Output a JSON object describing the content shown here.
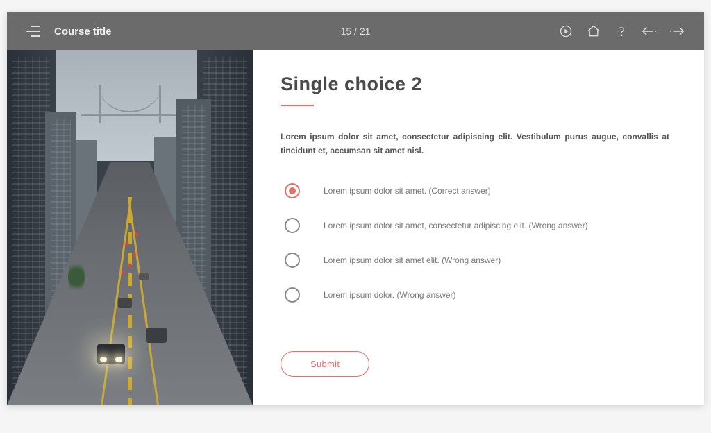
{
  "header": {
    "course_title": "Course title",
    "progress": "15 / 21"
  },
  "question": {
    "title": "Single choice 2",
    "body": "Lorem ipsum dolor sit amet, consectetur adipiscing elit. Vestibulum purus augue, convallis at tincidunt et, accumsan sit amet nisl.",
    "options": [
      {
        "label": "Lorem ipsum dolor sit amet. (Correct answer)",
        "selected": true
      },
      {
        "label": "Lorem ipsum dolor sit amet, consectetur adipiscing elit. (Wrong answer)",
        "selected": false
      },
      {
        "label": "Lorem ipsum dolor sit amet elit. (Wrong answer)",
        "selected": false
      },
      {
        "label": "Lorem ipsum dolor. (Wrong answer)",
        "selected": false
      }
    ],
    "submit_label": "Submit"
  },
  "colors": {
    "accent": "#ef6b61",
    "header_bg": "#6b6b6b"
  }
}
